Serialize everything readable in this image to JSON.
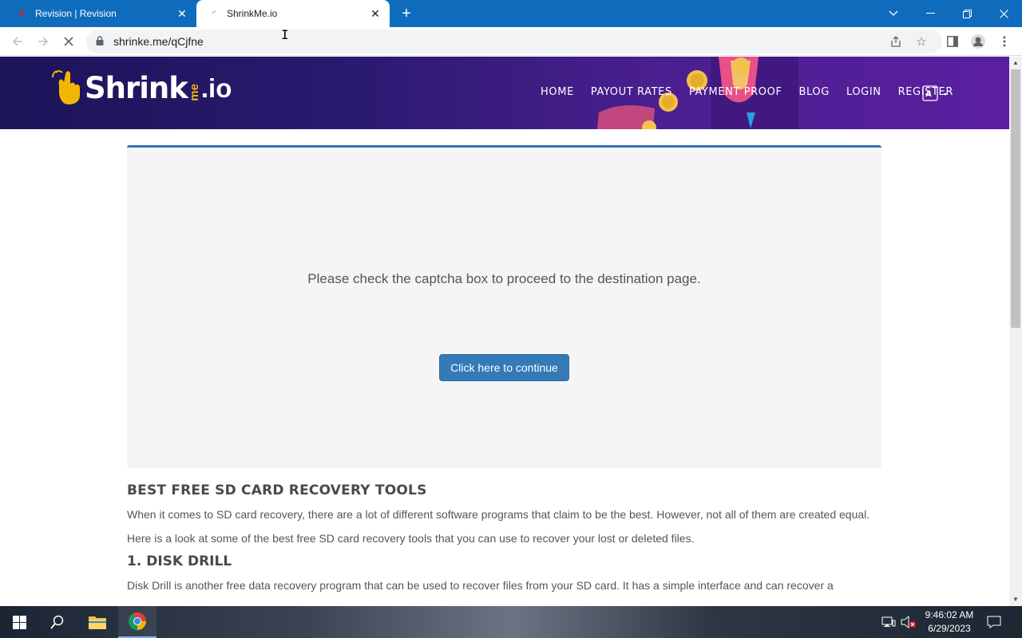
{
  "browser": {
    "tabs": [
      {
        "title": "Revision | Revision",
        "active": false
      },
      {
        "title": "ShrinkMe.io",
        "active": true
      }
    ],
    "url": "shrinke.me/qCjfne"
  },
  "site": {
    "logo": {
      "main": "Shrink",
      "me": "me",
      "io": ".io"
    },
    "nav": [
      "HOME",
      "PAYOUT RATES",
      "PAYMENT PROOF",
      "BLOG",
      "LOGIN",
      "REGISTER"
    ]
  },
  "captcha": {
    "message": "Please check the captcha box to proceed to the destination page.",
    "button": "Click here to continue"
  },
  "article": {
    "heading": "BEST FREE SD CARD RECOVERY TOOLS",
    "paragraphs": [
      "When it comes to SD card recovery, there are a lot of different software programs that claim to be the best. However, not all of them are created equal.",
      "Here is a look at some of the best free SD card recovery tools that you can use to recover your lost or deleted files."
    ],
    "subheading": "1. DISK DRILL",
    "partial": "Disk Drill is another free data recovery program that can be used to recover files from your SD card. It has a simple interface and can recover a"
  },
  "taskbar": {
    "time": "9:46:02 AM",
    "date": "6/29/2023"
  },
  "colors": {
    "chrome_titlebar": "#0f6cbd",
    "header_start": "#1b1458",
    "header_end": "#5a1fa0",
    "button": "#337ab7",
    "captcha_border": "#2f72b4"
  }
}
